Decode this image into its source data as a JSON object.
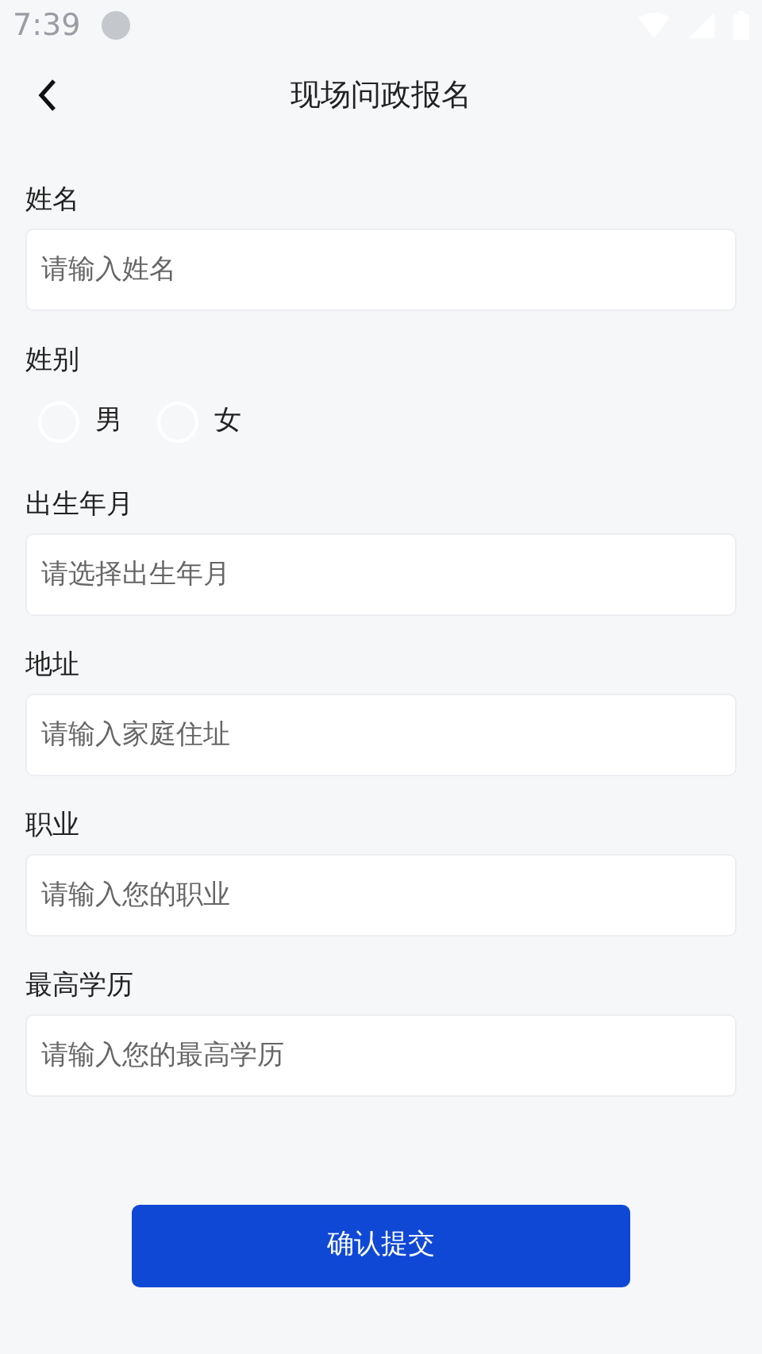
{
  "status_bar": {
    "time": "7:39"
  },
  "header": {
    "title": "现场问政报名"
  },
  "form": [
    {
      "kind": "text",
      "label": "姓名",
      "placeholder": "请输入姓名"
    },
    {
      "kind": "radio",
      "label": "姓别",
      "options": [
        {
          "label": "男",
          "selected": false
        },
        {
          "label": "女",
          "selected": false
        }
      ]
    },
    {
      "kind": "text",
      "label": "出生年月",
      "placeholder": "请选择出生年月"
    },
    {
      "kind": "text",
      "label": "地址",
      "placeholder": "请输入家庭住址"
    },
    {
      "kind": "text",
      "label": "职业",
      "placeholder": "请输入您的职业"
    },
    {
      "kind": "text",
      "label": "最高学历",
      "placeholder": "请输入您的最高学历"
    }
  ],
  "submit_button": "确认提交"
}
